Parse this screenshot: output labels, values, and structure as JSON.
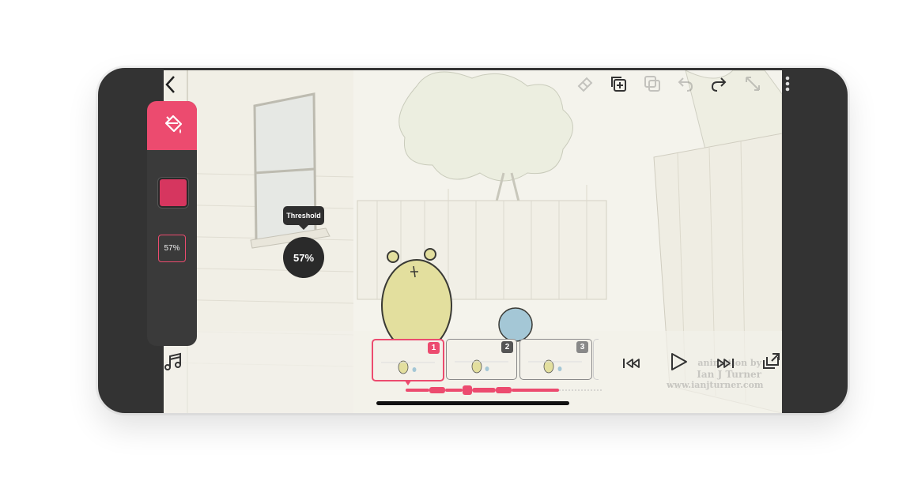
{
  "toolbar": {
    "back_icon": "chevron-left-icon",
    "icons": [
      "eraser-icon",
      "duplicate-layers-icon",
      "copy-icon",
      "undo-icon",
      "redo-icon",
      "fullscreen-icon",
      "more-vertical-icon"
    ]
  },
  "tool_panel": {
    "active_tool_icon": "paint-bucket-icon",
    "fill_color": "#d6365f",
    "threshold_value": "57%"
  },
  "threshold_popup": {
    "label": "Threshold",
    "value": "57%"
  },
  "frames": [
    {
      "number": "1",
      "active": true,
      "badge_color": "#ec4b6f"
    },
    {
      "number": "2",
      "active": false,
      "badge_color": "#555555"
    },
    {
      "number": "3",
      "active": false,
      "badge_color": "#888888"
    }
  ],
  "playback": {
    "icons": [
      "skip-back-icon",
      "play-icon",
      "skip-forward-icon",
      "export-icon",
      "music-icon"
    ]
  },
  "watermark": {
    "line1": "animation by",
    "line2": "Ian J Turner",
    "line3": "www.ianjturner.com"
  },
  "colors": {
    "accent": "#ec4b6f",
    "panel": "#3a3a3a",
    "frame_bg": "#333333"
  }
}
